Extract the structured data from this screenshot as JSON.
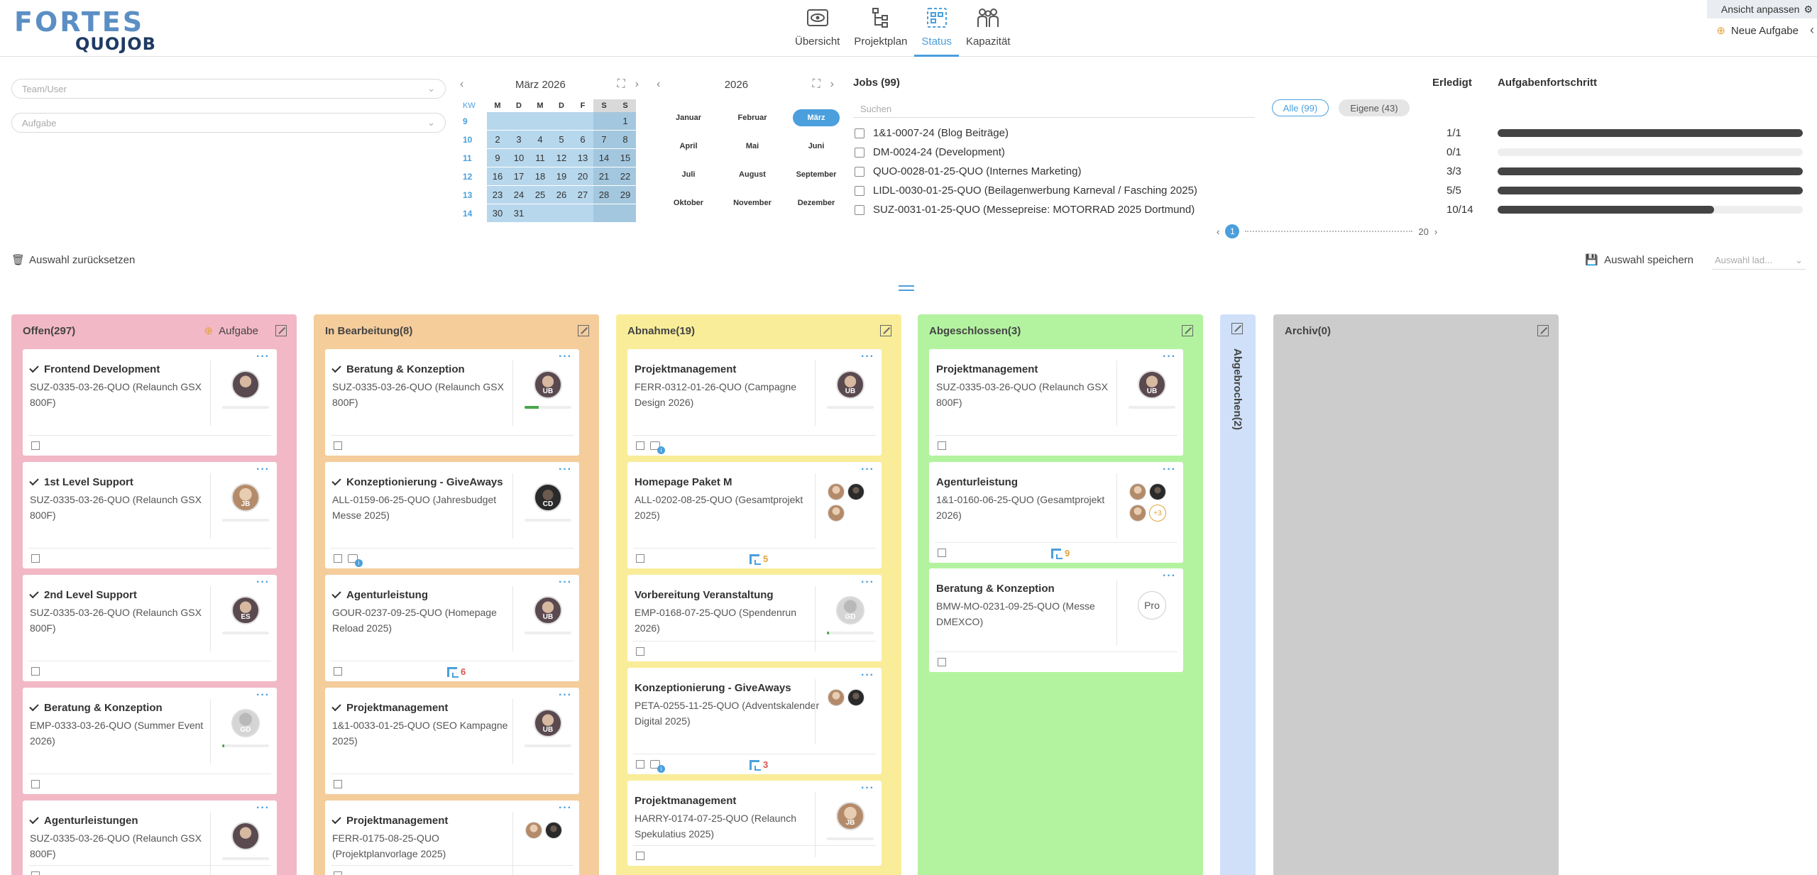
{
  "logo": {
    "top": "FORTES",
    "bottom": "QUOJOB"
  },
  "nav": [
    {
      "label": "Übersicht",
      "icon": "eye-icon"
    },
    {
      "label": "Projektplan",
      "icon": "tree-icon"
    },
    {
      "label": "Status",
      "icon": "status-board-icon"
    },
    {
      "label": "Kapazität",
      "icon": "people-icon"
    }
  ],
  "header": {
    "ansicht": "Ansicht anpassen",
    "neue_aufgabe": "Neue Aufgabe"
  },
  "filters": {
    "team_placeholder": "Team/User",
    "task_placeholder": "Aufgabe",
    "reset": "Auswahl zurücksetzen",
    "save": "Auswahl speichern",
    "load_placeholder": "Auswahl lad..."
  },
  "calendar": {
    "title": "März 2026",
    "kw_label": "KW",
    "weekdays": [
      "M",
      "D",
      "M",
      "D",
      "F",
      "S",
      "S"
    ],
    "weeks": [
      {
        "kw": "9",
        "days": [
          "",
          "",
          "",
          "",
          "",
          "",
          "1"
        ]
      },
      {
        "kw": "10",
        "days": [
          "2",
          "3",
          "4",
          "5",
          "6",
          "7",
          "8"
        ]
      },
      {
        "kw": "11",
        "days": [
          "9",
          "10",
          "11",
          "12",
          "13",
          "14",
          "15"
        ]
      },
      {
        "kw": "12",
        "days": [
          "16",
          "17",
          "18",
          "19",
          "20",
          "21",
          "22"
        ]
      },
      {
        "kw": "13",
        "days": [
          "23",
          "24",
          "25",
          "26",
          "27",
          "28",
          "29"
        ]
      },
      {
        "kw": "14",
        "days": [
          "30",
          "31",
          "",
          "",
          "",
          "",
          ""
        ]
      }
    ]
  },
  "months": {
    "year": "2026",
    "items": [
      "Januar",
      "Februar",
      "März",
      "April",
      "Mai",
      "Juni",
      "Juli",
      "August",
      "September",
      "Oktober",
      "November",
      "Dezember"
    ],
    "active": "März"
  },
  "jobs": {
    "title": "Jobs (99)",
    "col_done": "Erledigt",
    "col_progress": "Aufgabenfortschritt",
    "search_placeholder": "Suchen",
    "filter_all": "Alle (99)",
    "filter_own": "Eigene (43)",
    "rows": [
      {
        "name": "1&1-0007-24 (Blog Beiträge)",
        "done": "1/1",
        "progress": 1.0
      },
      {
        "name": "DM-0024-24 (Development)",
        "done": "0/1",
        "progress": 0.0
      },
      {
        "name": "QUO-0028-01-25-QUO (Internes Marketing)",
        "done": "3/3",
        "progress": 1.0
      },
      {
        "name": "LIDL-0030-01-25-QUO (Beilagenwerbung Karneval / Fasching 2025)",
        "done": "5/5",
        "progress": 1.0
      },
      {
        "name": "SUZ-0031-01-25-QUO (Messepreise: MOTORRAD 2025 Dortmund)",
        "done": "10/14",
        "progress": 0.71
      }
    ],
    "pager": {
      "current": "1",
      "last": "20"
    }
  },
  "columns": [
    {
      "title": "Offen(297)",
      "extra": "Aufgabe",
      "color": "#f2b8c6",
      "cards": [
        {
          "title": "Frontend Development",
          "sub": "SUZ-0335-03-26-QUO (Relaunch GSX 800F)",
          "initials": "",
          "progress": 0
        },
        {
          "title": "1st Level Support",
          "sub": "SUZ-0335-03-26-QUO (Relaunch GSX 800F)",
          "initials": "JB",
          "progress": 0
        },
        {
          "title": "2nd Level Support",
          "sub": "SUZ-0335-03-26-QUO (Relaunch GSX 800F)",
          "initials": "ES",
          "progress": 0
        },
        {
          "title": "Beratung & Konzeption",
          "sub": "EMP-0333-03-26-QUO (Summer Event 2026)",
          "initials": "GD",
          "progress": 0.05
        },
        {
          "title": "Agenturleistungen",
          "sub": "SUZ-0335-03-26-QUO (Relaunch GSX 800F)",
          "initials": "",
          "progress": 0
        }
      ]
    },
    {
      "title": "In Bearbeitung(8)",
      "color": "#f4cd9b",
      "cards": [
        {
          "title": "Beratung & Konzeption",
          "sub": "SUZ-0335-03-26-QUO (Relaunch GSX 800F)",
          "initials": "UB",
          "progress": 0.3
        },
        {
          "title": "Konzeptionierung - GiveAways",
          "sub": "ALL-0159-06-25-QUO (Jahresbudget Messe 2025)",
          "initials": "CD",
          "progress": 0
        },
        {
          "title": "Agenturleistung",
          "sub": "GOUR-0237-09-25-QUO (Homepage Reload 2025)",
          "initials": "UB",
          "progress": 0,
          "subtasks": "6"
        },
        {
          "title": "Projektmanagement",
          "sub": "1&1-0033-01-25-QUO (SEO Kampagne 2025)",
          "initials": "UB",
          "progress": 0
        },
        {
          "title": "Projektmanagement",
          "sub": "FERR-0175-08-25-QUO (Projektplanvorlage 2025)",
          "initials": "",
          "progress": 0
        }
      ]
    },
    {
      "title": "Abnahme(19)",
      "color": "#f9ed9a",
      "cards": [
        {
          "title": "Projektmanagement",
          "sub": "FERR-0312-01-26-QUO (Campagne Design 2026)",
          "initials": "UB",
          "progress": 0
        },
        {
          "title": "Homepage Paket M",
          "sub": "ALL-0202-08-25-QUO (Gesamtprojekt 2025)",
          "initials": "",
          "progress": 0,
          "subtasks": "5"
        },
        {
          "title": "Vorbereitung Veranstaltung",
          "sub": "EMP-0168-07-25-QUO (Spendenrun 2026)",
          "initials": "GD",
          "progress": 0.05
        },
        {
          "title": "Konzeptionierung - GiveAways",
          "sub": "PETA-0255-11-25-QUO (Adventskalender Digital 2025)",
          "initials": "",
          "progress": 0,
          "subtasks": "3"
        },
        {
          "title": "Projektmanagement",
          "sub": "HARRY-0174-07-25-QUO (Relaunch Spekulatius 2025)",
          "initials": "JB",
          "progress": 0
        }
      ]
    },
    {
      "title": "Abgeschlossen(3)",
      "color": "#b3f3a0",
      "cards": [
        {
          "title": "Projektmanagement",
          "sub": "SUZ-0335-03-26-QUO (Relaunch GSX 800F)",
          "initials": "UB",
          "progress": 0
        },
        {
          "title": "Agenturleistung",
          "sub": "1&1-0160-06-25-QUO (Gesamtprojekt 2026)",
          "initials": "",
          "progress": 0,
          "subtasks": "9",
          "plus": "+3"
        },
        {
          "title": "Beratung & Konzeption",
          "sub": "BMW-MO-0231-09-25-QUO (Messe DMEXCO)",
          "initials": "Pro",
          "progress": 0
        }
      ]
    },
    {
      "title": "Abgebrochen(2)",
      "color": "#cfe0f8"
    },
    {
      "title": "Archiv(0)",
      "color": "#cccccc"
    }
  ]
}
